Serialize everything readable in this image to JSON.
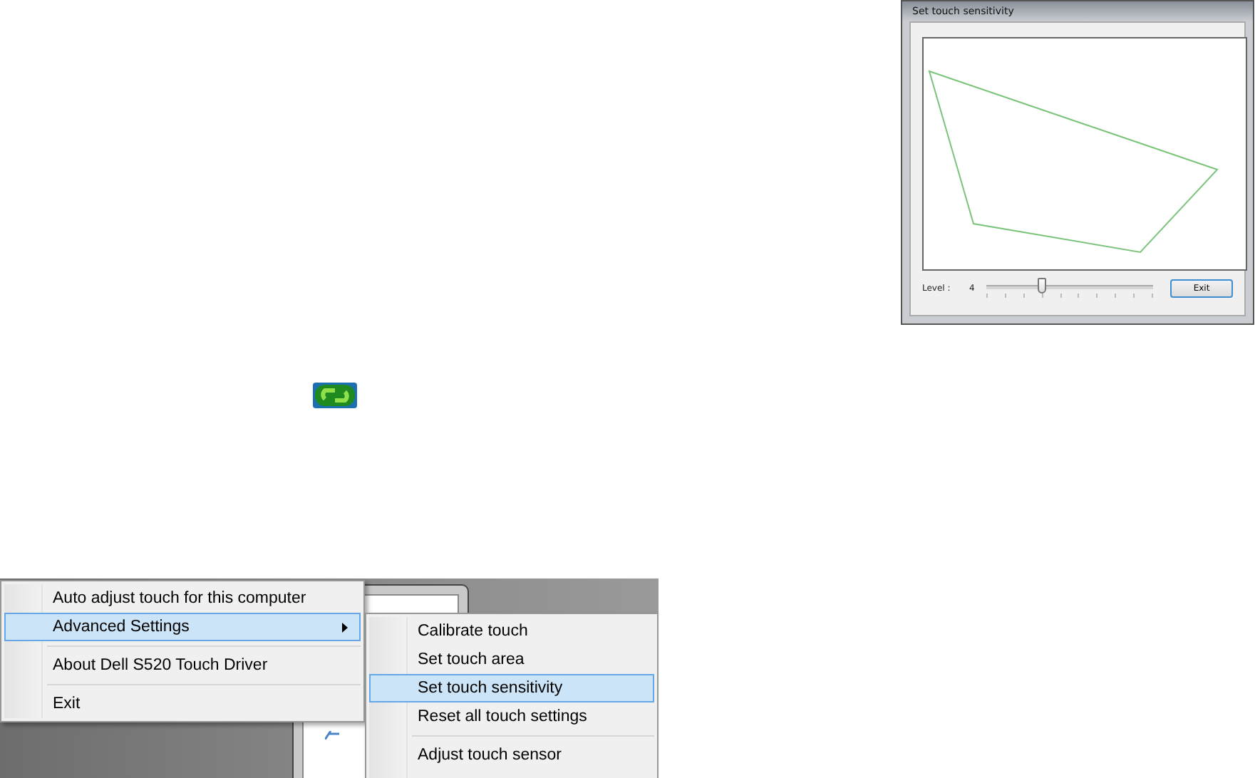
{
  "dialog": {
    "title": "Set touch sensitivity",
    "level_label": "Level :",
    "level_value": "4",
    "slider": {
      "level": 0.33
    },
    "button": "Exit"
  },
  "menu": {
    "items": [
      {
        "kind": "item",
        "label": "Auto adjust touch for this computer",
        "selected": false,
        "has_submenu": false
      },
      {
        "kind": "item",
        "label": "Advanced Settings",
        "selected": true,
        "has_submenu": true
      },
      {
        "kind": "separator"
      },
      {
        "kind": "item",
        "label": "About Dell S520 Touch Driver",
        "selected": false,
        "has_submenu": false
      },
      {
        "kind": "separator"
      },
      {
        "kind": "item",
        "label": "Exit",
        "selected": false,
        "has_submenu": false
      }
    ]
  },
  "submenu": {
    "items": [
      {
        "kind": "item",
        "label": "Calibrate touch",
        "selected": false
      },
      {
        "kind": "item",
        "label": "Set touch area",
        "selected": false
      },
      {
        "kind": "item",
        "label": "Set touch sensitivity",
        "selected": true
      },
      {
        "kind": "item",
        "label": "Reset all touch settings",
        "selected": false
      },
      {
        "kind": "separator"
      },
      {
        "kind": "item",
        "label": "Adjust touch sensor",
        "selected": false
      }
    ]
  }
}
